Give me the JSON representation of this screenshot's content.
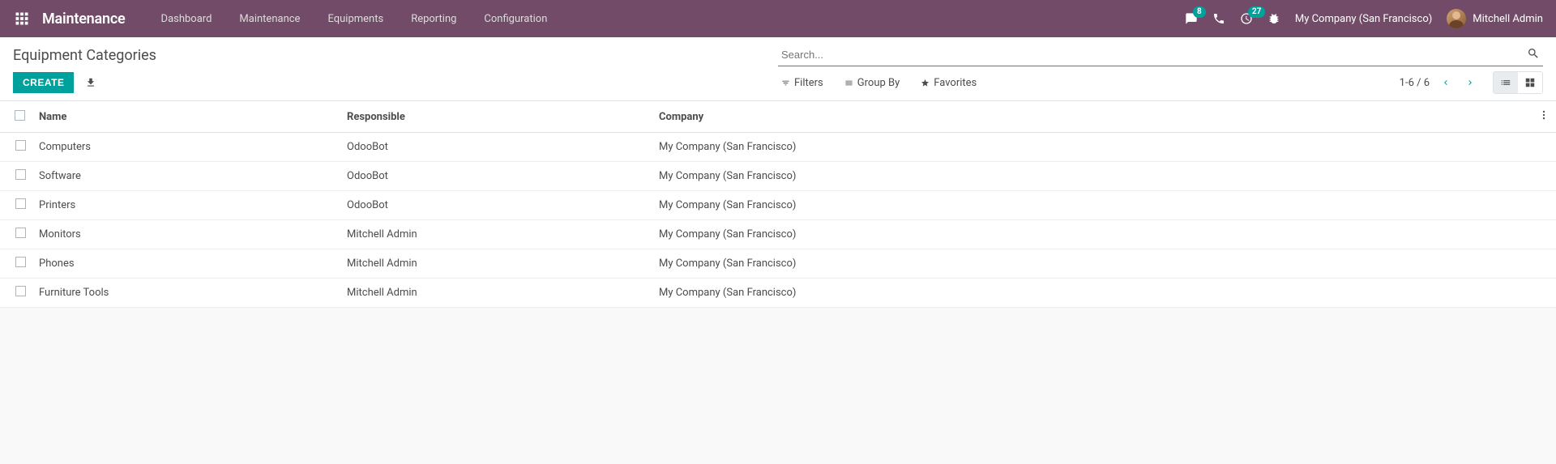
{
  "topnav": {
    "brand": "Maintenance",
    "links": [
      "Dashboard",
      "Maintenance",
      "Equipments",
      "Reporting",
      "Configuration"
    ],
    "messages_badge": "8",
    "activities_badge": "27",
    "company": "My Company (San Francisco)",
    "user": "Mitchell Admin"
  },
  "control_panel": {
    "title": "Equipment Categories",
    "create_label": "CREATE",
    "search_placeholder": "Search...",
    "filters_label": "Filters",
    "groupby_label": "Group By",
    "favorites_label": "Favorites",
    "pager": "1-6 / 6"
  },
  "table": {
    "columns": {
      "name": "Name",
      "responsible": "Responsible",
      "company": "Company"
    },
    "rows": [
      {
        "name": "Computers",
        "responsible": "OdooBot",
        "company": "My Company (San Francisco)"
      },
      {
        "name": "Software",
        "responsible": "OdooBot",
        "company": "My Company (San Francisco)"
      },
      {
        "name": "Printers",
        "responsible": "OdooBot",
        "company": "My Company (San Francisco)"
      },
      {
        "name": "Monitors",
        "responsible": "Mitchell Admin",
        "company": "My Company (San Francisco)"
      },
      {
        "name": "Phones",
        "responsible": "Mitchell Admin",
        "company": "My Company (San Francisco)"
      },
      {
        "name": "Furniture Tools",
        "responsible": "Mitchell Admin",
        "company": "My Company (San Francisco)"
      }
    ]
  }
}
